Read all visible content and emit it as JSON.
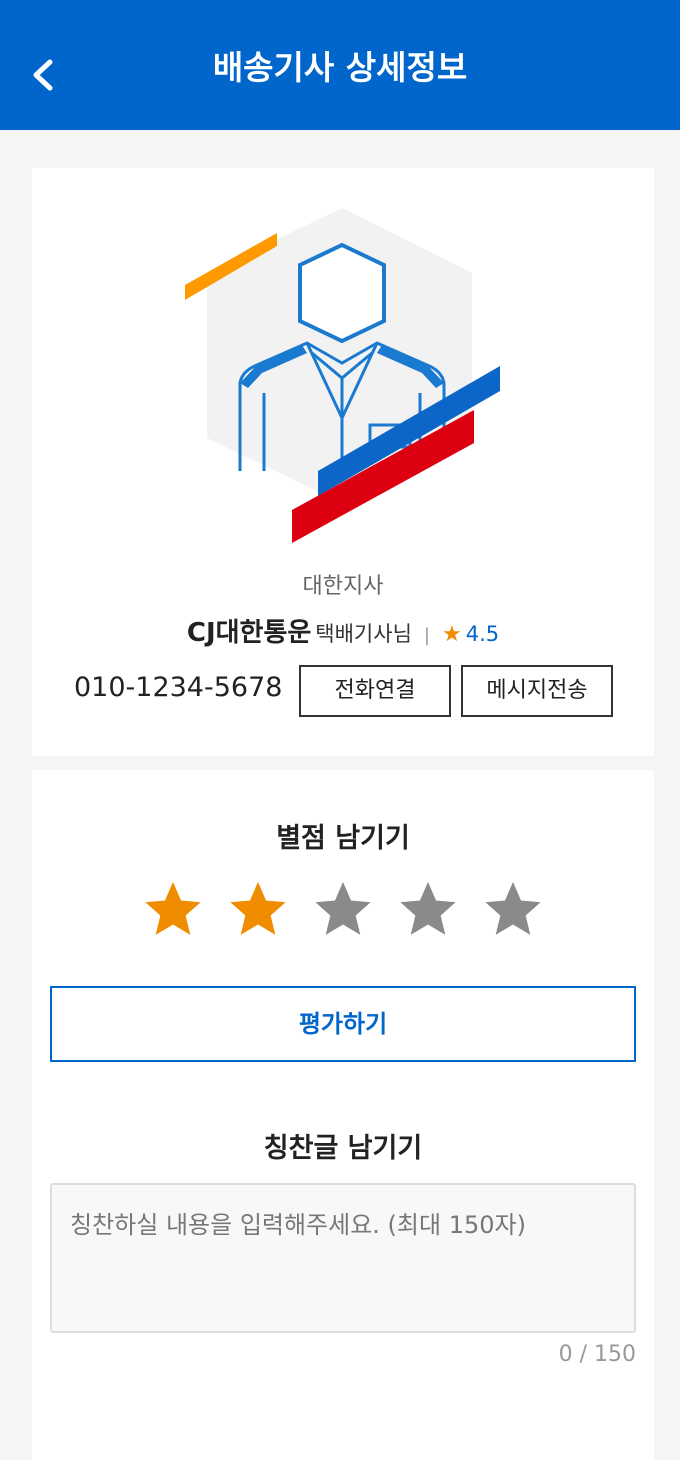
{
  "header": {
    "title": "배송기사 상세정보",
    "back_icon": "chevron-left-icon"
  },
  "profile": {
    "branch": "대한지사",
    "company": "CJ대한통운",
    "role": "택배기사님",
    "separator": "|",
    "rating_icon": "star-icon",
    "rating": "4.5",
    "phone": "010-1234-5678",
    "call_label": "전화연결",
    "message_label": "메시지전송"
  },
  "review": {
    "rate_title": "별점 남기기",
    "selected_stars": 2,
    "total_stars": 5,
    "evaluate_label": "평가하기",
    "praise_title": "칭찬글 남기기",
    "praise_placeholder": "칭찬하실 내용을 입력해주세요. (최대 150자)",
    "praise_value": "",
    "counter": "0 / 150"
  },
  "colors": {
    "brand_blue": "#0066cc",
    "star_active": "#f08c00",
    "star_inactive": "#8a8a8a",
    "accent_red": "#dd0011",
    "accent_orange": "#ff9900"
  }
}
